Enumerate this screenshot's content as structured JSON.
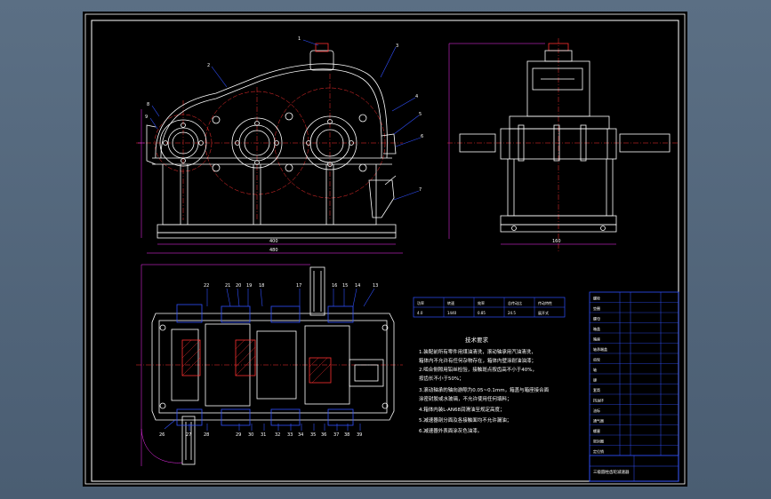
{
  "viewport": {
    "background": "#000000",
    "frame_color": "#ffffff",
    "line_color": "#ffffff",
    "center_line_color": "#ff3030",
    "dim_color": "#ff30ff",
    "leader_color": "#3050ff",
    "table_color": "#3050ff"
  },
  "drawing": {
    "front_view": {
      "part_numbers": [
        "1",
        "2",
        "3",
        "4",
        "5",
        "6",
        "7",
        "8",
        "9"
      ],
      "bottom_dims": [
        "400",
        "480"
      ]
    },
    "side_view": {
      "bottom_dims": [
        "160"
      ]
    },
    "top_view": {
      "top_part_numbers": [
        "22",
        "21",
        "20",
        "19",
        "18",
        "17",
        "16",
        "15",
        "14",
        "13"
      ],
      "bottom_part_numbers": [
        "26",
        "27",
        "28",
        "29",
        "30",
        "31",
        "32",
        "33",
        "34",
        "35",
        "36",
        "37",
        "38",
        "39"
      ]
    },
    "spec_table": {
      "header": [
        "功率",
        "转速",
        "效率",
        "总传动比",
        "传动特性"
      ],
      "row": [
        "4.0",
        "1440",
        "0.85",
        "24.5",
        "展开式"
      ]
    },
    "tech_requirements": {
      "title": "技术要求",
      "lines": [
        "1.装配前所有零件用煤油清洗，滚动轴承用汽油清洗，",
        "  箱体内不允许有任何杂物存在，箱体内壁涂耐油油漆；",
        "2.啮合侧隙用铅丝检验，接触斑点按齿高不小于40%，",
        "  按齿长不小于50%；",
        "3.滚动轴承的轴向游隙为0.05~0.1mm，箱盖与箱座接合面",
        "  涂密封胶或水玻璃，不允许使用任何填料；",
        "4.箱体内装L-AN68润滑油至规定高度；",
        "5.减速器剖分面及各接触面均不允许漏油；",
        "6.减速器外表面涂灰色油漆。"
      ]
    },
    "parts_list": {
      "rows": [
        "螺栓",
        "垫圈",
        "螺母",
        "箱盖",
        "箱座",
        "轴承端盖",
        "齿轮",
        "轴",
        "键",
        "套筒",
        "挡油环",
        "油标",
        "通气器",
        "螺塞",
        "密封圈",
        "定位销"
      ],
      "title": "三级圆柱齿轮减速器"
    }
  }
}
